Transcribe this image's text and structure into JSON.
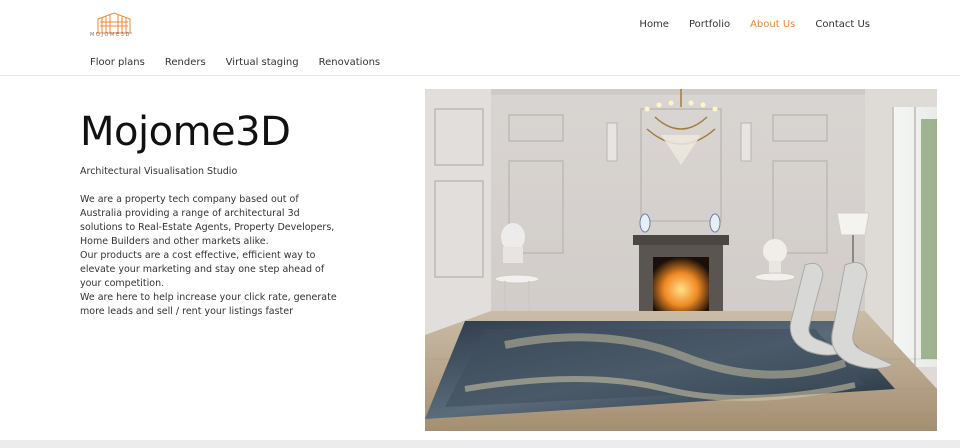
{
  "brand": {
    "logo_text": "MOJOME3D"
  },
  "top_nav": [
    {
      "label": "Home",
      "active": false
    },
    {
      "label": "Portfolio",
      "active": false
    },
    {
      "label": "About Us",
      "active": true
    },
    {
      "label": "Contact Us",
      "active": false
    }
  ],
  "sub_nav": [
    {
      "label": "Floor plans"
    },
    {
      "label": "Renders"
    },
    {
      "label": "Virtual staging"
    },
    {
      "label": "Renovations"
    }
  ],
  "hero": {
    "title": "Mojome3D",
    "subtitle": "Architectural Visualisation Studio",
    "paragraphs": [
      "We are a property tech company based out of Australia providing a range of architectural 3d solutions to Real-Estate Agents, Property Developers, Home Builders and other markets alike.",
      "Our products are a cost effective, efficient way to elevate your marketing and stay one step ahead of your competition.",
      "We are here to help increase your click rate, generate more leads and sell / rent your listings faster"
    ]
  },
  "colors": {
    "accent": "#e88a3a",
    "text": "#333333",
    "divider": "#e6e6e6"
  }
}
